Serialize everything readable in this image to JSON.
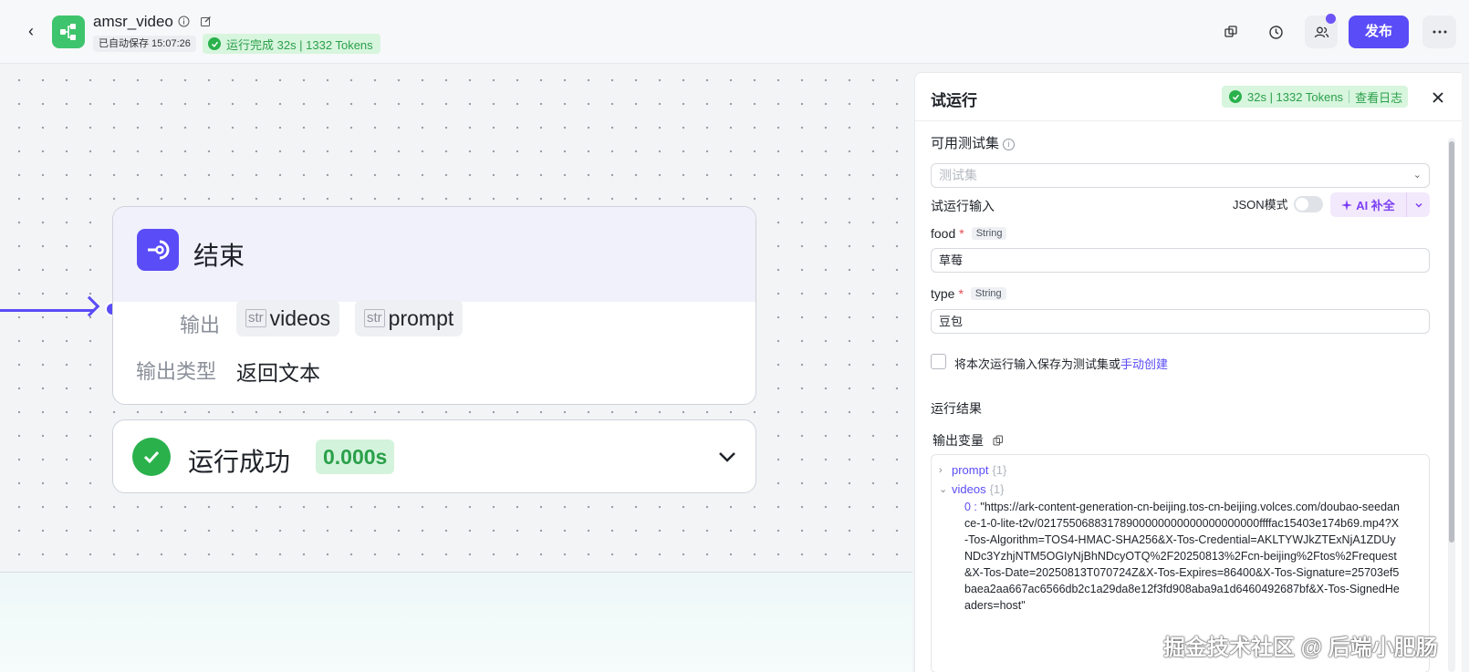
{
  "header": {
    "app_title": "amsr_video",
    "autosave": "已自动保存 15:07:26",
    "run_status": "运行完成 32s | 1332 Tokens",
    "publish_label": "发布"
  },
  "canvas": {
    "end_node": {
      "title": "结束",
      "output_label": "输出",
      "outputs": [
        {
          "type": "str",
          "name": "videos"
        },
        {
          "type": "str",
          "name": "prompt"
        }
      ],
      "output_type_label": "输出类型",
      "output_type_value": "返回文本"
    },
    "result_node": {
      "status": "运行成功",
      "time": "0.000s"
    }
  },
  "panel": {
    "title": "试运行",
    "status_text": "32s | 1332 Tokens",
    "log_link": "查看日志",
    "test_set_label": "可用测试集",
    "test_set_placeholder": "测试集",
    "run_input_label": "试运行输入",
    "json_mode_label": "JSON模式",
    "ai_button": "AI 补全",
    "fields": [
      {
        "name": "food",
        "type": "String",
        "value": "草莓"
      },
      {
        "name": "type",
        "type": "String",
        "value": "豆包"
      }
    ],
    "save_text": "将本次运行输入保存为测试集或",
    "manual_link": "手动创建",
    "result_label": "运行结果",
    "output_var_label": "输出变量",
    "tree": {
      "prompt_key": "prompt",
      "prompt_count": "{1}",
      "videos_key": "videos",
      "videos_count": "{1}",
      "video_index": "0 :",
      "video_url": "\"https://ark-content-generation-cn-beijing.tos-cn-beijing.volces.com/doubao-seedance-1-0-lite-t2v/02175506883178900000000000000000000ffffac15403e174b69.mp4?X-Tos-Algorithm=TOS4-HMAC-SHA256&X-Tos-Credential=AKLTYWJkZTExNjA1ZDUyNDc3YzhjNTM5OGIyNjBhNDcyOTQ%2F20250813%2Fcn-beijing%2Ftos%2Frequest&X-Tos-Date=20250813T070724Z&X-Tos-Expires=86400&X-Tos-Signature=25703ef5baea2aa667ac6566db2c1a29da8e12f3fd908aba9a1d6460492687bf&X-Tos-SignedHeaders=host\""
    }
  },
  "watermark": "掘金技术社区 @ 后端小肥肠",
  "colors": {
    "accent": "#5a4cf6",
    "success": "#2ab14c",
    "app_icon": "#3ec46d"
  }
}
